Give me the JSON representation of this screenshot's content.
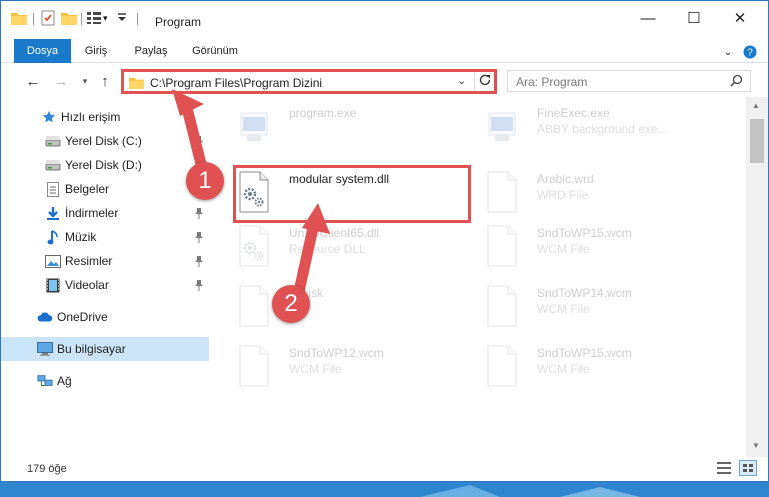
{
  "window": {
    "title": "Program",
    "controls": {
      "minimize": "—",
      "maximize": "☐",
      "close": "✕"
    }
  },
  "ribbon": {
    "tabs": [
      "Dosya",
      "Giriş",
      "Paylaş",
      "Görünüm"
    ]
  },
  "nav": {
    "address": "C:\\Program Files\\Program Dizini",
    "search_placeholder": "Ara: Program"
  },
  "sidebar": {
    "items": [
      {
        "label": "Hızlı erişim",
        "icon": "star-icon"
      },
      {
        "label": "Yerel Disk (C:)",
        "icon": "drive-icon",
        "pinned": true
      },
      {
        "label": "Yerel Disk (D:)",
        "icon": "drive-icon",
        "pinned": true
      },
      {
        "label": "Belgeler",
        "icon": "documents-icon",
        "pinned": true
      },
      {
        "label": "İndirmeler",
        "icon": "downloads-icon",
        "pinned": true
      },
      {
        "label": "Müzik",
        "icon": "music-icon",
        "pinned": true
      },
      {
        "label": "Resimler",
        "icon": "pictures-icon",
        "pinned": true
      },
      {
        "label": "Videolar",
        "icon": "videos-icon",
        "pinned": true
      },
      {
        "label": "OneDrive",
        "icon": "cloud-icon"
      },
      {
        "label": "Bu bilgisayar",
        "icon": "computer-icon",
        "selected": true
      },
      {
        "label": "Ağ",
        "icon": "network-icon"
      }
    ]
  },
  "files": [
    {
      "name": "program.exe",
      "desc": "",
      "icon": "exe-icon",
      "faded": true
    },
    {
      "name": "FineExec.exe",
      "desc": "ABBY background exe...",
      "icon": "exe-icon",
      "faded": true
    },
    {
      "name": "modular system.dll",
      "desc": "",
      "icon": "dll-gear-icon",
      "faded": false
    },
    {
      "name": "Arabic.wrd",
      "desc": "WRD File",
      "icon": "file-icon",
      "faded": true
    },
    {
      "name": "UnzipClient65.dll",
      "desc": "Resource DLL",
      "icon": "dll-gear-icon",
      "faded": true
    },
    {
      "name": "SndToWP15.wcm",
      "desc": "WCM File",
      "icon": "file-icon",
      "faded": true
    },
    {
      "name": "Unrisk",
      "desc": "File",
      "icon": "file-icon",
      "faded": true
    },
    {
      "name": "SndToWP14.wcm",
      "desc": "WCM File",
      "icon": "file-icon",
      "faded": true
    },
    {
      "name": "SndToWP12.wcm",
      "desc": "WCM File",
      "icon": "file-icon",
      "faded": true
    },
    {
      "name": "SndToWP15.wcm",
      "desc": "WCM File",
      "icon": "file-icon",
      "faded": true
    }
  ],
  "status": {
    "item_count": "179 öğe"
  },
  "annotations": {
    "step1": "1",
    "step2": "2"
  },
  "colors": {
    "accent": "#1979ca",
    "highlight": "#e05151",
    "selected_bg": "#cce4f7"
  }
}
